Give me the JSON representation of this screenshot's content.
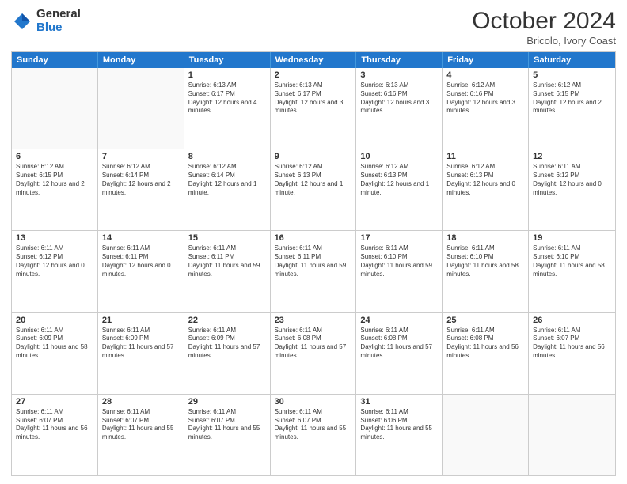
{
  "logo": {
    "general": "General",
    "blue": "Blue"
  },
  "header": {
    "month": "October 2024",
    "location": "Bricolo, Ivory Coast"
  },
  "days": [
    "Sunday",
    "Monday",
    "Tuesday",
    "Wednesday",
    "Thursday",
    "Friday",
    "Saturday"
  ],
  "weeks": [
    [
      {
        "day": "",
        "sunrise": "",
        "sunset": "",
        "daylight": ""
      },
      {
        "day": "",
        "sunrise": "",
        "sunset": "",
        "daylight": ""
      },
      {
        "day": "1",
        "sunrise": "Sunrise: 6:13 AM",
        "sunset": "Sunset: 6:17 PM",
        "daylight": "Daylight: 12 hours and 4 minutes."
      },
      {
        "day": "2",
        "sunrise": "Sunrise: 6:13 AM",
        "sunset": "Sunset: 6:17 PM",
        "daylight": "Daylight: 12 hours and 3 minutes."
      },
      {
        "day": "3",
        "sunrise": "Sunrise: 6:13 AM",
        "sunset": "Sunset: 6:16 PM",
        "daylight": "Daylight: 12 hours and 3 minutes."
      },
      {
        "day": "4",
        "sunrise": "Sunrise: 6:12 AM",
        "sunset": "Sunset: 6:16 PM",
        "daylight": "Daylight: 12 hours and 3 minutes."
      },
      {
        "day": "5",
        "sunrise": "Sunrise: 6:12 AM",
        "sunset": "Sunset: 6:15 PM",
        "daylight": "Daylight: 12 hours and 2 minutes."
      }
    ],
    [
      {
        "day": "6",
        "sunrise": "Sunrise: 6:12 AM",
        "sunset": "Sunset: 6:15 PM",
        "daylight": "Daylight: 12 hours and 2 minutes."
      },
      {
        "day": "7",
        "sunrise": "Sunrise: 6:12 AM",
        "sunset": "Sunset: 6:14 PM",
        "daylight": "Daylight: 12 hours and 2 minutes."
      },
      {
        "day": "8",
        "sunrise": "Sunrise: 6:12 AM",
        "sunset": "Sunset: 6:14 PM",
        "daylight": "Daylight: 12 hours and 1 minute."
      },
      {
        "day": "9",
        "sunrise": "Sunrise: 6:12 AM",
        "sunset": "Sunset: 6:13 PM",
        "daylight": "Daylight: 12 hours and 1 minute."
      },
      {
        "day": "10",
        "sunrise": "Sunrise: 6:12 AM",
        "sunset": "Sunset: 6:13 PM",
        "daylight": "Daylight: 12 hours and 1 minute."
      },
      {
        "day": "11",
        "sunrise": "Sunrise: 6:12 AM",
        "sunset": "Sunset: 6:13 PM",
        "daylight": "Daylight: 12 hours and 0 minutes."
      },
      {
        "day": "12",
        "sunrise": "Sunrise: 6:11 AM",
        "sunset": "Sunset: 6:12 PM",
        "daylight": "Daylight: 12 hours and 0 minutes."
      }
    ],
    [
      {
        "day": "13",
        "sunrise": "Sunrise: 6:11 AM",
        "sunset": "Sunset: 6:12 PM",
        "daylight": "Daylight: 12 hours and 0 minutes."
      },
      {
        "day": "14",
        "sunrise": "Sunrise: 6:11 AM",
        "sunset": "Sunset: 6:11 PM",
        "daylight": "Daylight: 12 hours and 0 minutes."
      },
      {
        "day": "15",
        "sunrise": "Sunrise: 6:11 AM",
        "sunset": "Sunset: 6:11 PM",
        "daylight": "Daylight: 11 hours and 59 minutes."
      },
      {
        "day": "16",
        "sunrise": "Sunrise: 6:11 AM",
        "sunset": "Sunset: 6:11 PM",
        "daylight": "Daylight: 11 hours and 59 minutes."
      },
      {
        "day": "17",
        "sunrise": "Sunrise: 6:11 AM",
        "sunset": "Sunset: 6:10 PM",
        "daylight": "Daylight: 11 hours and 59 minutes."
      },
      {
        "day": "18",
        "sunrise": "Sunrise: 6:11 AM",
        "sunset": "Sunset: 6:10 PM",
        "daylight": "Daylight: 11 hours and 58 minutes."
      },
      {
        "day": "19",
        "sunrise": "Sunrise: 6:11 AM",
        "sunset": "Sunset: 6:10 PM",
        "daylight": "Daylight: 11 hours and 58 minutes."
      }
    ],
    [
      {
        "day": "20",
        "sunrise": "Sunrise: 6:11 AM",
        "sunset": "Sunset: 6:09 PM",
        "daylight": "Daylight: 11 hours and 58 minutes."
      },
      {
        "day": "21",
        "sunrise": "Sunrise: 6:11 AM",
        "sunset": "Sunset: 6:09 PM",
        "daylight": "Daylight: 11 hours and 57 minutes."
      },
      {
        "day": "22",
        "sunrise": "Sunrise: 6:11 AM",
        "sunset": "Sunset: 6:09 PM",
        "daylight": "Daylight: 11 hours and 57 minutes."
      },
      {
        "day": "23",
        "sunrise": "Sunrise: 6:11 AM",
        "sunset": "Sunset: 6:08 PM",
        "daylight": "Daylight: 11 hours and 57 minutes."
      },
      {
        "day": "24",
        "sunrise": "Sunrise: 6:11 AM",
        "sunset": "Sunset: 6:08 PM",
        "daylight": "Daylight: 11 hours and 57 minutes."
      },
      {
        "day": "25",
        "sunrise": "Sunrise: 6:11 AM",
        "sunset": "Sunset: 6:08 PM",
        "daylight": "Daylight: 11 hours and 56 minutes."
      },
      {
        "day": "26",
        "sunrise": "Sunrise: 6:11 AM",
        "sunset": "Sunset: 6:07 PM",
        "daylight": "Daylight: 11 hours and 56 minutes."
      }
    ],
    [
      {
        "day": "27",
        "sunrise": "Sunrise: 6:11 AM",
        "sunset": "Sunset: 6:07 PM",
        "daylight": "Daylight: 11 hours and 56 minutes."
      },
      {
        "day": "28",
        "sunrise": "Sunrise: 6:11 AM",
        "sunset": "Sunset: 6:07 PM",
        "daylight": "Daylight: 11 hours and 55 minutes."
      },
      {
        "day": "29",
        "sunrise": "Sunrise: 6:11 AM",
        "sunset": "Sunset: 6:07 PM",
        "daylight": "Daylight: 11 hours and 55 minutes."
      },
      {
        "day": "30",
        "sunrise": "Sunrise: 6:11 AM",
        "sunset": "Sunset: 6:07 PM",
        "daylight": "Daylight: 11 hours and 55 minutes."
      },
      {
        "day": "31",
        "sunrise": "Sunrise: 6:11 AM",
        "sunset": "Sunset: 6:06 PM",
        "daylight": "Daylight: 11 hours and 55 minutes."
      },
      {
        "day": "",
        "sunrise": "",
        "sunset": "",
        "daylight": ""
      },
      {
        "day": "",
        "sunrise": "",
        "sunset": "",
        "daylight": ""
      }
    ]
  ]
}
